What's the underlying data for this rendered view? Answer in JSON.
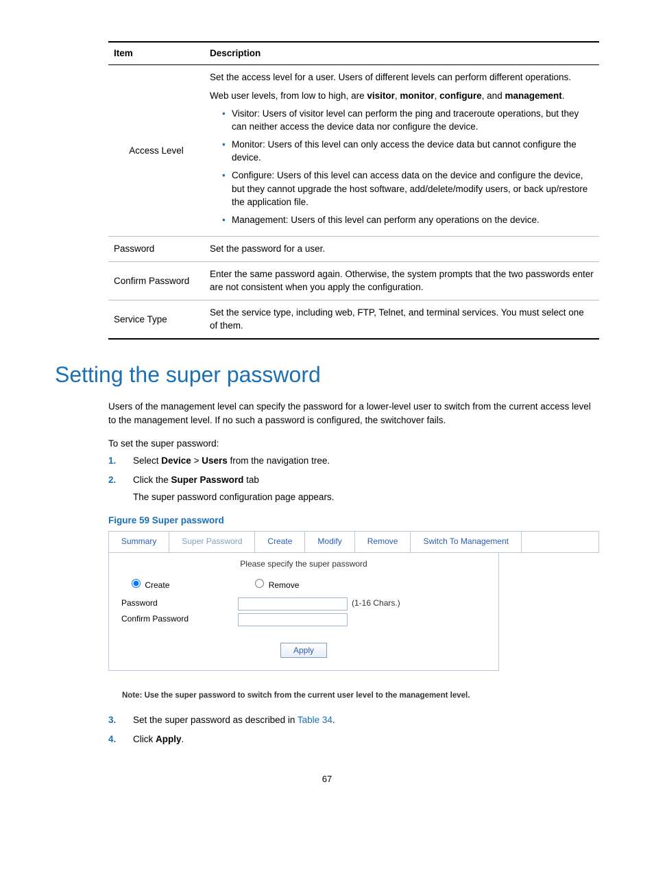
{
  "table": {
    "headers": {
      "item": "Item",
      "desc": "Description"
    },
    "rows": {
      "access_level": {
        "item": "Access Level",
        "intro1": "Set the access level for a user. Users of different levels can perform different operations.",
        "intro2_pre": "Web user levels, from low to high, are ",
        "lv1": "visitor",
        "c1": ", ",
        "lv2": "monitor",
        "c2": ", ",
        "lv3": "configure",
        "c3": ", and ",
        "lv4": "management",
        "c4": ".",
        "bullets": [
          "Visitor: Users of visitor level can perform the ping and traceroute operations, but they can neither access the device data nor configure the device.",
          "Monitor: Users of this level can only access the device data but cannot configure the device.",
          "Configure: Users of this level can access data on the device and configure the device, but they cannot upgrade the host software, add/delete/modify users, or back up/restore the application file.",
          "Management: Users of this level can perform any operations on the device."
        ]
      },
      "password": {
        "item": "Password",
        "desc": "Set the password for a user."
      },
      "confirm": {
        "item": "Confirm Password",
        "desc": "Enter the same password again. Otherwise, the system prompts that the two passwords enter are not consistent when you apply the configuration."
      },
      "service": {
        "item": "Service Type",
        "desc": "Set the service type, including web, FTP, Telnet, and terminal services. You must select one of them."
      }
    }
  },
  "heading": "Setting the super password",
  "intro_para": "Users of the management level can specify the password for a lower-level user to switch from the current access level to the management level. If no such a password is configured, the switchover fails.",
  "to_set": "To set the super password:",
  "steps12": [
    {
      "num": "1.",
      "pre": "Select ",
      "b1": "Device",
      "mid": " > ",
      "b2": "Users",
      "post": " from the navigation tree."
    },
    {
      "num": "2.",
      "pre": "Click the ",
      "b1": "Super Password",
      "post": " tab"
    }
  ],
  "step2_sub": "The super password configuration page appears.",
  "figure_caption": "Figure 59 Super password",
  "screenshot": {
    "tabs": [
      "Summary",
      "Super Password",
      "Create",
      "Modify",
      "Remove",
      "Switch To Management"
    ],
    "active_tab_index": 1,
    "instruction": "Please specify the super password",
    "radio_create": "Create",
    "radio_remove": "Remove",
    "password_label": "Password",
    "password_hint": "(1-16 Chars.)",
    "confirm_label": "Confirm Password",
    "apply": "Apply",
    "note": "Note: Use the super password to switch from the current user level to the management level."
  },
  "steps34": [
    {
      "num": "3.",
      "pre": "Set the super password as described in ",
      "link": "Table 34",
      "post": "."
    },
    {
      "num": "4.",
      "pre": "Click ",
      "b1": "Apply",
      "post": "."
    }
  ],
  "page_number": "67"
}
